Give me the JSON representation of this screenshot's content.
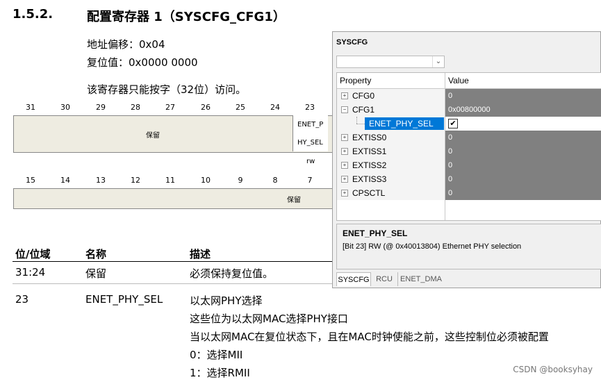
{
  "section": {
    "number": "1.5.2.",
    "title": "配置寄存器 1（SYSCFG_CFG1）"
  },
  "info": {
    "offset": "地址偏移：0x04",
    "reset": "复位值：0x0000 0000",
    "access": "该寄存器只能按字（32位）访问。"
  },
  "register": {
    "upper_bits": [
      "31",
      "30",
      "29",
      "28",
      "27",
      "26",
      "25",
      "24",
      "23"
    ],
    "lower_bits": [
      "15",
      "14",
      "13",
      "12",
      "11",
      "10",
      "9",
      "8",
      "7"
    ],
    "upper_reserved": "保留",
    "enet_line1": "ENET_P",
    "enet_line2": "HY_SEL",
    "enet_access": "rw",
    "lower_reserved": "保留"
  },
  "table": {
    "headers": [
      "位/位域",
      "名称",
      "描述"
    ],
    "rows": [
      {
        "bits": "31:24",
        "name": "保留",
        "desc": [
          "必须保持复位值。"
        ]
      },
      {
        "bits": "23",
        "name": "ENET_PHY_SEL",
        "desc": [
          "以太网PHY选择",
          "这些位为以太网MAC选择PHY接口",
          "当以太网MAC在复位状态下，且在MAC时钟使能之前，这些控制位必须被配置",
          "0：选择MII",
          "1：选择RMII"
        ]
      }
    ]
  },
  "panel": {
    "title": "SYSCFG",
    "combo_value": "",
    "col_property": "Property",
    "col_value": "Value",
    "rows": [
      {
        "name": "CFG0",
        "value": "0",
        "expander": "+"
      },
      {
        "name": "CFG1",
        "value": "0x00800000",
        "expander": "−"
      },
      {
        "name": "ENET_PHY_SEL",
        "value": "✔",
        "expander": ""
      },
      {
        "name": "EXTISS0",
        "value": "0",
        "expander": "+"
      },
      {
        "name": "EXTISS1",
        "value": "0",
        "expander": "+"
      },
      {
        "name": "EXTISS2",
        "value": "0",
        "expander": "+"
      },
      {
        "name": "EXTISS3",
        "value": "0",
        "expander": "+"
      },
      {
        "name": "CPSCTL",
        "value": "0",
        "expander": "+"
      }
    ],
    "desc_title": "ENET_PHY_SEL",
    "desc_text": "[Bit 23] RW (@ 0x40013804) Ethernet PHY selection",
    "tabs": [
      "SYSCFG",
      "RCU",
      "ENET_DMA"
    ],
    "active_tab": "SYSCFG"
  },
  "watermark": "CSDN @booksyhay"
}
